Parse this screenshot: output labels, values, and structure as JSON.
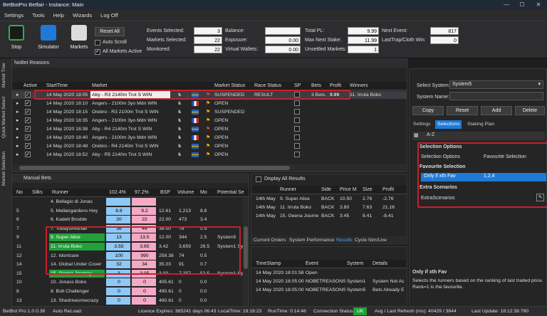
{
  "app": {
    "title": "BetBotPro Betfair - Instance: Main"
  },
  "menu": [
    "Settings",
    "Tools",
    "Help",
    "Wizards",
    "Log Off"
  ],
  "toolbar": {
    "stop_label": "Stop",
    "simulator_label": "Simulator",
    "markets_label": "Markets",
    "reset_all_label": "Reset All",
    "auto_scroll_label": "Auto Scroll",
    "all_markets_active_label": "All Markets Active"
  },
  "stats": {
    "events_selected_label": "Events Selected:",
    "events_selected": "3",
    "markets_selected_label": "Markets Selected:",
    "markets_selected": "22",
    "monitored_label": "Monitored:",
    "monitored": "22",
    "balance_label": "Balance:",
    "balance": "",
    "exposure_label": "Exposure:",
    "exposure": "0.00",
    "virtual_wallets_label": "Virtual Wallets:",
    "virtual_wallets": "0.00",
    "total_pl_label": "Total PL:",
    "total_pl": "9.99",
    "max_next_stake_label": "Max Next Stake:",
    "max_next_stake": "11.99",
    "unsettled_label": "Unsettled Markets:",
    "unsettled": "1",
    "next_event_label": "Next Event:",
    "next_event": "817",
    "lasttrap_label": "LastTrap/Cloth Win:",
    "lasttrap": "0"
  },
  "side_tabs": [
    "Market Tree",
    "Quick Market Select",
    "Market Selection"
  ],
  "markets": {
    "panel_title": "NoBet Reasons",
    "columns": [
      "Active",
      "StartTime",
      "Market",
      "Market Status",
      "Race Status",
      "SP",
      "Bets",
      "Profit",
      "Winners"
    ],
    "rows": [
      {
        "start": "14 May 2020 18:05",
        "market": "Aby - R3 2140m Trot S WIN",
        "status": "SUSPENDED",
        "race": "RESULT",
        "bets": "3 Bets.",
        "profit": "9.99",
        "winners": "11. Irruta Boko",
        "flag": "se"
      },
      {
        "start": "14 May 2020 18:10",
        "market": "Angers - 2100m 3yo Mdn WIN",
        "status": "OPEN",
        "race": "",
        "bets": "",
        "profit": "",
        "winners": "",
        "flag": "fr"
      },
      {
        "start": "14 May 2020 18:15",
        "market": "Orebro - R3 2100m Trot S WIN",
        "status": "SUSPENDED",
        "race": "",
        "bets": "",
        "profit": "",
        "winners": "",
        "flag": "se"
      },
      {
        "start": "14 May 2020 18:35",
        "market": "Angers - 2100m 3yo Mdn WIN",
        "status": "OPEN",
        "race": "",
        "bets": "",
        "profit": "",
        "winners": "",
        "flag": "fr"
      },
      {
        "start": "14 May 2020 18:38",
        "market": "Aby - R4 2140m Trot S WIN",
        "status": "OPEN",
        "race": "",
        "bets": "",
        "profit": "",
        "winners": "",
        "flag": "se"
      },
      {
        "start": "14 May 2020 18:40",
        "market": "Angers - 2100m 3yo Mdn WIN",
        "status": "OPEN",
        "race": "",
        "bets": "",
        "profit": "",
        "winners": "",
        "flag": "fr"
      },
      {
        "start": "14 May 2020 18:48",
        "market": "Orebro - R4 2140m Trot S WIN",
        "status": "OPEN",
        "race": "",
        "bets": "",
        "profit": "",
        "winners": "",
        "flag": "se"
      },
      {
        "start": "14 May 2020 18:52",
        "market": "Aby - R5 2140m Trot S WIN",
        "status": "OPEN",
        "race": "",
        "bets": "",
        "profit": "",
        "winners": "",
        "flag": "se"
      }
    ]
  },
  "manual_bets": {
    "title": "Manual Bets",
    "columns": [
      "No",
      "Silks",
      "Runner",
      "102.4%",
      "97.2%",
      "BSP",
      "Volume",
      "Mo",
      "Potential Se"
    ],
    "rows": [
      {
        "no": "",
        "runner": "4. Bellagio di Jonas",
        "back": "",
        "lay": "",
        "bsp": "",
        "vol": "",
        "mo": "",
        "pot": "",
        "hl": false
      },
      {
        "no": "5",
        "runner": "5. Mellangardens Hey",
        "back": "8.8",
        "lay": "9.2",
        "bsp": "12.61",
        "vol": "1,213",
        "mo": "8.8",
        "pot": "",
        "hl": false
      },
      {
        "no": "6",
        "runner": "6. Kadett Brodde",
        "back": "20",
        "lay": "22",
        "bsp": "22.00",
        "vol": "473",
        "mo": "3.4",
        "pot": "",
        "hl": false
      },
      {
        "no": "7",
        "runner": "7. Todaysfreshair",
        "back": "36",
        "lay": "44",
        "bsp": "38.00",
        "vol": "76",
        "mo": "0.5",
        "pot": "",
        "hl": false
      },
      {
        "no": "9",
        "runner": "9. Super Alice",
        "back": "13",
        "lay": "13.5",
        "bsp": "12.00",
        "vol": "344",
        "mo": "2.5",
        "pot": "System5",
        "hl": true
      },
      {
        "no": "11",
        "runner": "11. Irruta Boko",
        "back": "3.55",
        "lay": "3.65",
        "bsp": "3.42",
        "vol": "3,659",
        "mo": "26.5",
        "pot": "System1 Sys",
        "hl": true
      },
      {
        "no": "12",
        "runner": "12. Idontcare",
        "back": "100",
        "lay": "990",
        "bsp": "258.38",
        "vol": "74",
        "mo": "0.5",
        "pot": "",
        "hl": false
      },
      {
        "no": "14",
        "runner": "14. Global Under Cover",
        "back": "32",
        "lay": "34",
        "bsp": "35.03",
        "vol": "91",
        "mo": "0.7",
        "pot": "",
        "hl": false
      },
      {
        "no": "15",
        "runner": "15. Geena Journey",
        "back": "3",
        "lay": "3.05",
        "bsp": "3.00",
        "vol": "7,257",
        "mo": "52.5",
        "pot": "System1 Sys",
        "hl": true
      },
      {
        "no": "10",
        "runner": "10. Jonass Boko",
        "back": "0",
        "lay": "0",
        "bsp": "405.61",
        "vol": "0",
        "mo": "0.0",
        "pot": "",
        "hl": false
      },
      {
        "no": "8",
        "runner": "8. Bolt Challenger",
        "back": "0",
        "lay": "0",
        "bsp": "490.61",
        "vol": "0",
        "mo": "0.0",
        "pot": "",
        "hl": false
      },
      {
        "no": "13",
        "runner": "13. Shedrivesmecrazy",
        "back": "0",
        "lay": "0",
        "bsp": "490.61",
        "vol": "0",
        "mo": "0.0",
        "pot": "",
        "hl": false
      }
    ]
  },
  "results": {
    "display_all_label": "Display All Results",
    "columns": [
      "Runner",
      "Side",
      "Price M",
      "Size",
      "Profit"
    ],
    "rows": [
      {
        "date": "14th May",
        "runner": "9. Super Alice",
        "side": "BACK",
        "price": "10.50",
        "size": "2.76",
        "profit": "-2.76"
      },
      {
        "date": "14th May",
        "runner": "11. Irruta Boko",
        "side": "BACK",
        "price": "3.80",
        "size": "7.63",
        "profit": "21.16"
      },
      {
        "date": "14th May",
        "runner": "15. Geena Journey",
        "side": "BACK",
        "price": "3.45",
        "size": "8.41",
        "profit": "-8.41"
      }
    ],
    "tabs": [
      "Current Orders",
      "System Performance",
      "Results",
      "Cycle Sim/Live"
    ]
  },
  "log": {
    "columns": [
      "TimeStamp",
      "Event",
      "System",
      "Details"
    ],
    "rows": [
      {
        "time": "14 May 2020 18:01:58",
        "event": "Open",
        "system": "",
        "details": ""
      },
      {
        "time": "14 May 2020 18:05:00",
        "event": "NOBETREASONS",
        "system": "System1",
        "details": "System Not Ac"
      },
      {
        "time": "14 May 2020 18:05:00",
        "event": "NOBETREASONS",
        "system": "System5",
        "details": "Bets Already E"
      }
    ]
  },
  "right_panel": {
    "select_system_label": "Select System:",
    "select_system_value": "System5",
    "system_name_label": "System Name:",
    "system_name_value": "",
    "copy_label": "Copy",
    "reset_label": "Reset",
    "add_label": "Add",
    "delete_label": "Delete",
    "tabs": [
      "Settings",
      "Selections",
      "Staking Plan"
    ],
    "sort_label": "A-Z",
    "sections": {
      "selection_options_header": "Selection Options",
      "selection_options_label": "Selection Options",
      "selection_options_value": "Favourite Selection",
      "favourite_selection_header": "Favourite Selection",
      "only_xth_fav_label": "Only if xth Fav",
      "only_xth_fav_value": "1,2,4",
      "extra_scenarios_header": "Extra Scenarios",
      "extra_scenarios_label": "ExtraScenarios"
    },
    "help_title": "Only if xth Fav",
    "help_text": "Selects the runners based on the ranking of last traded price. Rank=1 is the favourite."
  },
  "status": {
    "version": "BetBot Pro 1.0.0.36",
    "auto_reload": "Auto ReLoad:",
    "licence": "Licence Expires: 365241 days 06:43",
    "localtime": "LocalTime: 18:16:23",
    "runtime": "RunTime: 0:14:48",
    "connection_label": "Connection Status:",
    "connection_value": "UK",
    "avg_refresh": "Avg / Last Refresh (ms): 40429 / 3644",
    "last_update": "Last Update: 18:12:38.790"
  },
  "colors": {
    "back": "#8fc8f5",
    "lay": "#f4a9c4",
    "highlight": "#22a03a",
    "accent": "#1e7ad6",
    "red_outline": "#c8202a"
  }
}
